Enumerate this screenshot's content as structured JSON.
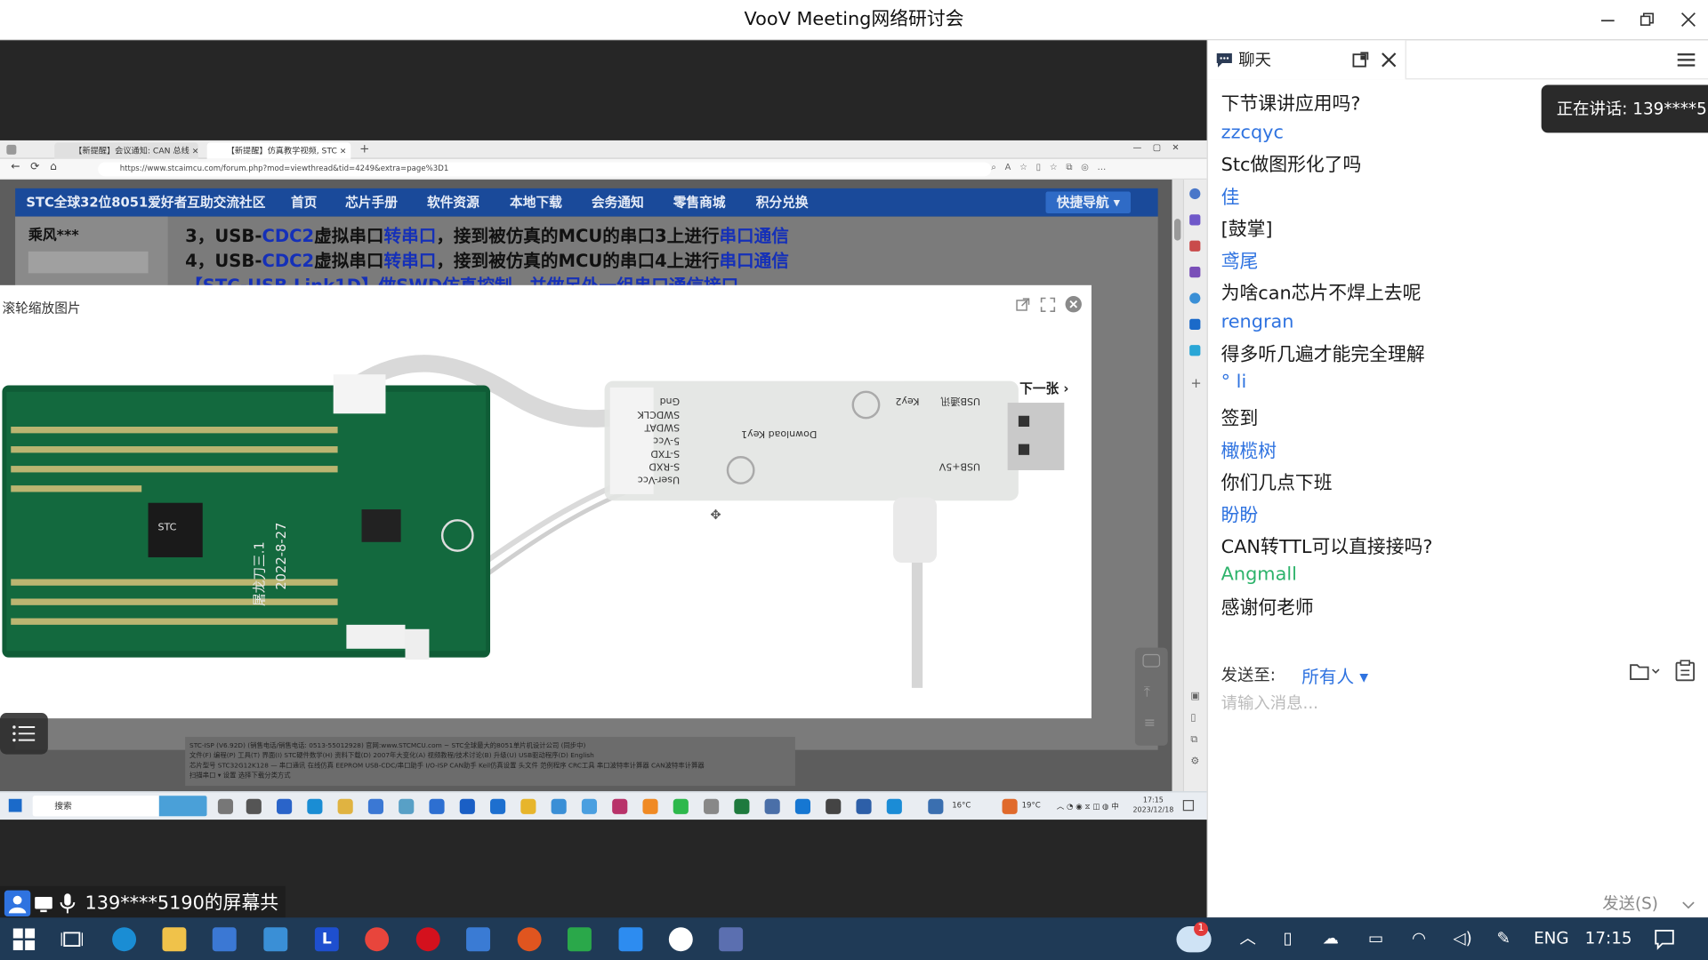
{
  "window": {
    "title": "VooV Meeting网络研讨会"
  },
  "remote": {
    "tabs": [
      "【新提醒】会议通知: CAN 总线 ×",
      "【新提醒】仿真教学视频, STC ×"
    ],
    "url": "https://www.stcaimcu.com/forum.php?mod=viewthread&tid=4249&extra=page%3D1",
    "forum_nav": [
      "STC全球32位8051爱好者互助交流社区",
      "首页",
      "芯片手册",
      "软件资源",
      "本地下载",
      "会务通知",
      "零售商城",
      "积分兑换"
    ],
    "quick_nav": "快捷导航 ▾",
    "poster": "乘风***",
    "post_lines": [
      {
        "pre": "3，USB-",
        "b1": "CDC2",
        "mid": "虚拟串口",
        "b2": "转串口",
        "post": "，接到被仿真的MCU的串口3上进行",
        "b3": "串口通信"
      },
      {
        "pre": "4，USB-",
        "b1": "CDC2",
        "mid": "虚拟串口",
        "b2": "转串口",
        "post": "，接到被仿真的MCU的串口4上进行",
        "b3": "串口通信"
      }
    ],
    "post_line3": "【STC-USB Link1D】做SWD仿真控制，并做另外一组串口通信接口",
    "footer_lines": [
      "STC-ISP (V6.92D) (销售电话/销售电话: 0513-55012928) 官网:www.STCMCU.com ~ STC全球最大的8051单片机设计公司 (同步中)",
      "文件(F)  编程(P)  工具(T)  界面(I)  STC硬件数学(H)  资料下载(D)  2007年大变化(A)  视频教程/技术讨论(B)  升级(U)  USB驱动程序(D)  English",
      "芯片型号 STC32G12K128    —  串口通讯  在线仿真  EEPROM  USB-CDC/串口助手  I/O-ISP  CAN助手  Keil仿真设置  头文件  范例程序  CRC工具  串口波特率计算器  CAN波特率计算器",
      "扫描串口  ▾       设置       选择下载分类方式"
    ],
    "viewer": {
      "title": "滚轮缩放图片",
      "next": "下一张 ›"
    },
    "board_labels": {
      "date": "2022-8-27",
      "name": "屠龙刀三.1",
      "chip": "STC",
      "d1": "Gnd",
      "d2": "SWDCLK",
      "d3": "SWDAT",
      "d4": "5-Vcc",
      "d5": "S-TXD",
      "d6": "S-RXD",
      "d7": "User-Vcc",
      "d8": "Download Key1",
      "d9": "Key2",
      "d10": "USB通讯",
      "d11": "USB+5V"
    },
    "taskbar": {
      "search": "搜索",
      "weather1": "16°C",
      "weather2": "19°C",
      "ime": "中",
      "time": "17:15",
      "date": "2023/12/18"
    }
  },
  "speaking": "正在讲话: 139****5190",
  "share_status": "139****5190的屏幕共享",
  "chat": {
    "tab_label": "聊天",
    "messages": [
      {
        "name": "",
        "text": "下节课讲应用吗?"
      },
      {
        "name": "zzcqyc",
        "text": "Stc做图形化了吗"
      },
      {
        "name": "佳",
        "text": "[鼓掌]"
      },
      {
        "name": "鸢尾",
        "text": "为啥can芯片不焊上去呢"
      },
      {
        "name": "rengran",
        "text": "得多听几遍才能完全理解"
      },
      {
        "name": "° li",
        "text": "签到"
      },
      {
        "name": "橄榄树",
        "text": "你们几点下班"
      },
      {
        "name": "盼盼",
        "text": "CAN转TTL可以直接接吗?"
      },
      {
        "name": "Angmall",
        "text": "感谢何老师"
      }
    ],
    "send_to_label": "发送至:",
    "send_to_value": "所有人 ▾",
    "input_placeholder": "请输入消息...",
    "send_button": "发送(S)"
  },
  "taskbar": {
    "lang": "ENG",
    "time": "17:15",
    "badge": "1"
  },
  "colors": {
    "chat_name": "#2f73e0",
    "chat_name_green": "#2db36b",
    "forum_nav": "#1a4a9a",
    "taskbar": "#1f3a56"
  }
}
